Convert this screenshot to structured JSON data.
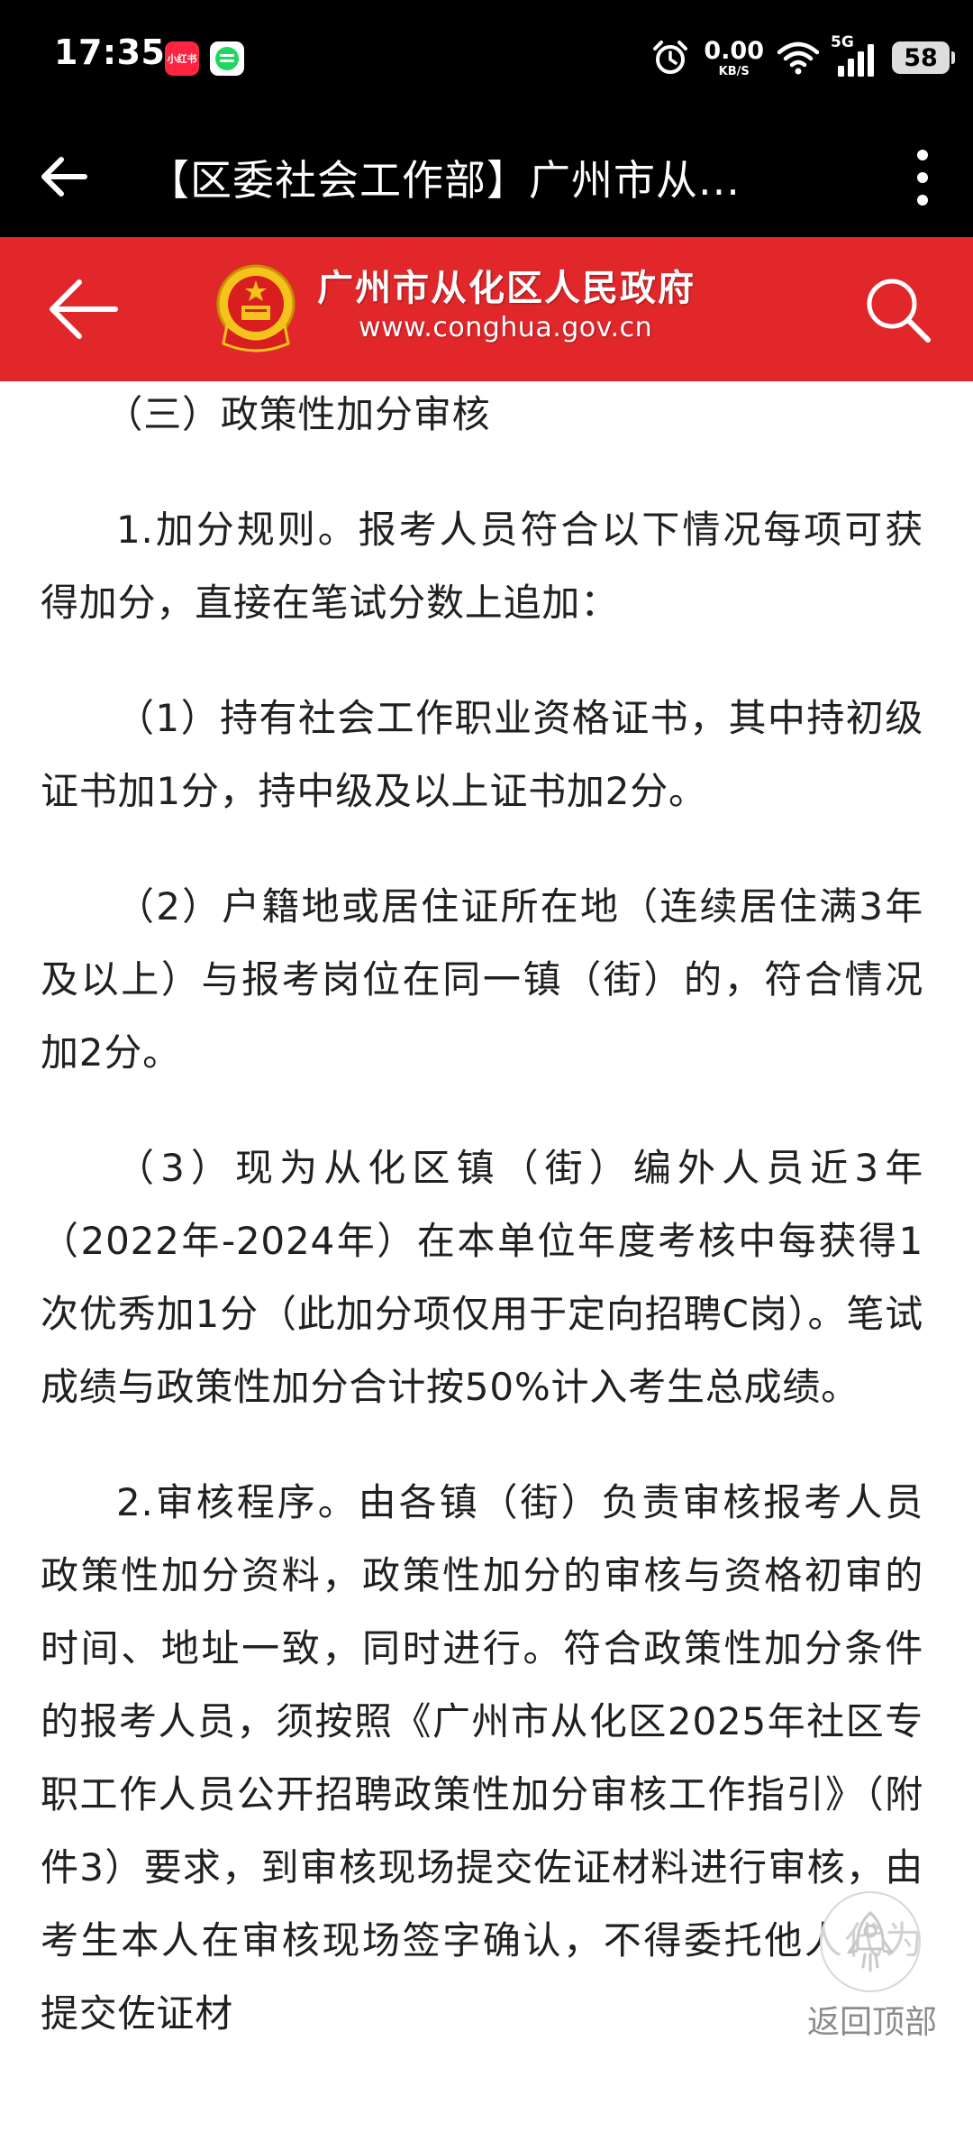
{
  "status_bar": {
    "time": "17:35",
    "app1_label": "小红书",
    "net_speed_value": "0.00",
    "net_speed_unit": "KB/S",
    "network_type": "5G",
    "battery": "58"
  },
  "title_bar": {
    "title": "【区委社会工作部】广州市从..."
  },
  "site_header": {
    "name": "广州市从化区人民政府",
    "url": "www.conghua.gov.cn"
  },
  "article": {
    "paragraphs": [
      "（三）政策性加分审核",
      "1.加分规则。报考人员符合以下情况每项可获得加分，直接在笔试分数上追加：",
      "（1）持有社会工作职业资格证书，其中持初级证书加1分，持中级及以上证书加2分。",
      "（2）户籍地或居住证所在地（连续居住满3年及以上）与报考岗位在同一镇（街）的，符合情况加2分。",
      "（3）现为从化区镇（街）编外人员近3年（2022年-2024年）在本单位年度考核中每获得1次优秀加1分（此加分项仅用于定向招聘C岗）。笔试成绩与政策性加分合计按50%计入考生总成绩。",
      "2.审核程序。由各镇（街）负责审核报考人员政策性加分资料，政策性加分的审核与资格初审的时间、地址一致，同时进行。符合政策性加分条件的报考人员，须按照《广州市从化区2025年社区专职工作人员公开招聘政策性加分审核工作指引》（附件3）要求，到审核现场提交佐证材料进行审核，由考生本人在审核现场签字确认，不得委托他人代为提交佐证材"
    ]
  },
  "back_to_top": {
    "label": "返回顶部"
  },
  "colors": {
    "header_red": "#e2272b",
    "bar_black": "#000000",
    "text": "#202020"
  }
}
